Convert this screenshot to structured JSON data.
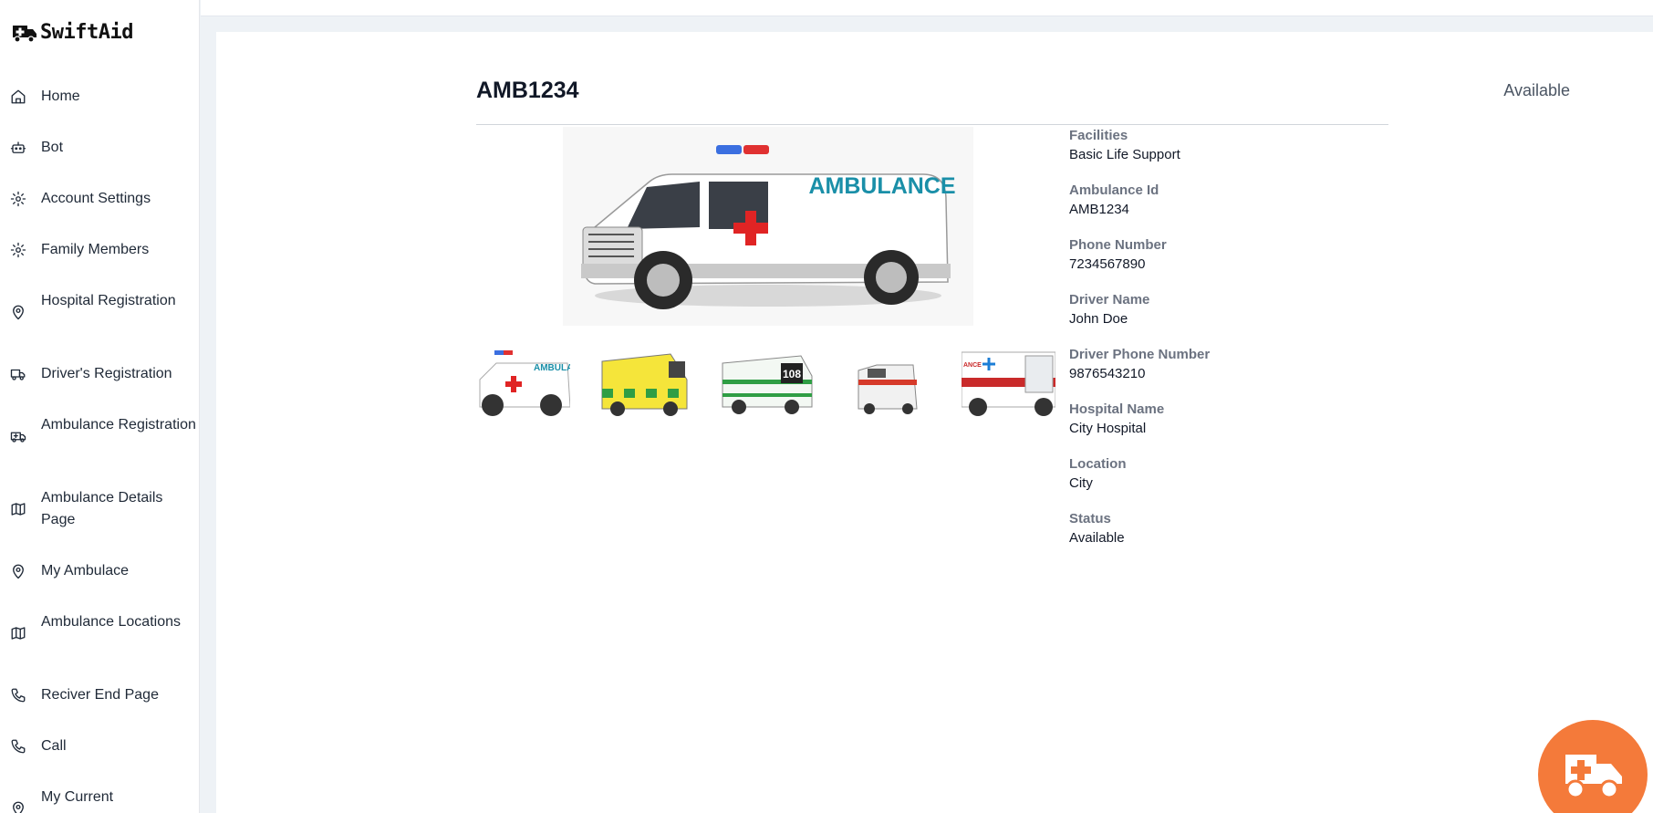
{
  "app": {
    "name": "SwiftAid"
  },
  "sidebar": {
    "items": [
      {
        "label": "Home",
        "icon": "home-icon"
      },
      {
        "label": "Bot",
        "icon": "bot-icon"
      },
      {
        "label": "Account Settings",
        "icon": "gear-icon"
      },
      {
        "label": "Family Members",
        "icon": "gear-icon"
      },
      {
        "label": "Hospital Registration",
        "icon": "map-pin-icon"
      },
      {
        "label": "Driver's Registration",
        "icon": "truck-icon"
      },
      {
        "label": "Ambulance Registration",
        "icon": "ambulance-icon"
      },
      {
        "label": "Ambulance Details Page",
        "icon": "map-icon"
      },
      {
        "label": "My Ambulace",
        "icon": "map-pin-icon"
      },
      {
        "label": "Ambulance Locations",
        "icon": "map-icon"
      },
      {
        "label": "Reciver End Page",
        "icon": "phone-icon"
      },
      {
        "label": "Call",
        "icon": "phone-icon"
      },
      {
        "label": "My Current",
        "icon": "map-pin-icon"
      }
    ]
  },
  "ambulance": {
    "title": "AMB1234",
    "status_badge": "Available",
    "main_image_text": "AMBULANCE",
    "thumbnail_texts": [
      "AMBULA",
      "",
      "108",
      "",
      "ANCE"
    ],
    "fields": [
      {
        "label": "Facilities",
        "value": "Basic Life Support"
      },
      {
        "label": "Ambulance Id",
        "value": "AMB1234"
      },
      {
        "label": "Phone Number",
        "value": "7234567890"
      },
      {
        "label": "Driver Name",
        "value": "John Doe"
      },
      {
        "label": "Driver Phone Number",
        "value": "9876543210"
      },
      {
        "label": "Hospital Name",
        "value": "City Hospital"
      },
      {
        "label": "Location",
        "value": "City"
      },
      {
        "label": "Status",
        "value": "Available"
      }
    ]
  },
  "colors": {
    "accent": "#f47a3a",
    "teal_text": "#1a8fa8",
    "red_cross": "#e02424"
  }
}
